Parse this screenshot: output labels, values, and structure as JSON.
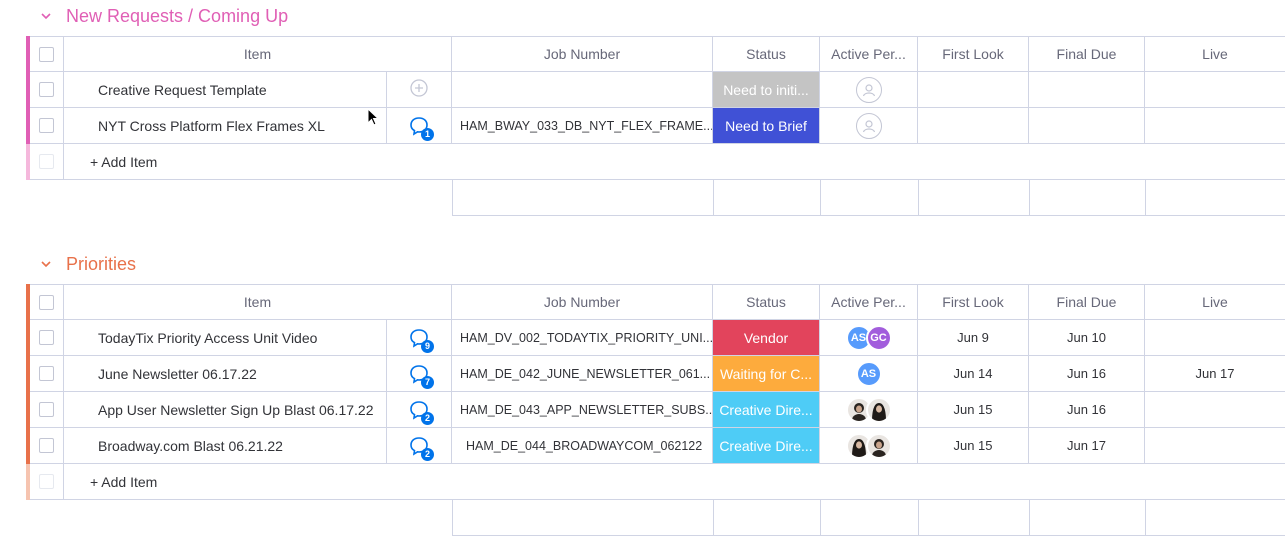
{
  "colors": {
    "group1": "#e2445c",
    "group1_title": "#e05fb5",
    "group2": "#ff642e",
    "group2_title": "#e8714a",
    "need_to_initiate": "#c4c4c4",
    "need_to_brief": "#4051d6",
    "vendor": "#e2445c",
    "waiting": "#fdab3d",
    "creative_director": "#4eccf6",
    "avatar_as": "#579bfc",
    "avatar_gc": "#a25ddc"
  },
  "headers": {
    "item": "Item",
    "job_number": "Job Number",
    "status": "Status",
    "active_person": "Active Per...",
    "first_look": "First Look",
    "final_due": "Final Due",
    "live": "Live"
  },
  "groups": [
    {
      "title": "New Requests / Coming Up",
      "add_item": "+ Add Item",
      "rows": [
        {
          "item": "Creative Request Template",
          "updates": "",
          "job_number": "",
          "status": "Need to initi...",
          "status_color": "#c4c4c4",
          "people": [],
          "first_look": "",
          "final_due": "",
          "live": ""
        },
        {
          "item": "NYT Cross Platform Flex Frames XL",
          "updates": "1",
          "job_number": "HAM_BWAY_033_DB_NYT_FLEX_FRAME...",
          "status": "Need to Brief",
          "status_color": "#4051d6",
          "people": [],
          "first_look": "",
          "final_due": "",
          "live": ""
        }
      ]
    },
    {
      "title": "Priorities",
      "add_item": "+ Add Item",
      "rows": [
        {
          "item": "TodayTix Priority Access Unit Video",
          "updates": "9",
          "job_number": "HAM_DV_002_TODAYTIX_PRIORITY_UNI...",
          "status": "Vendor",
          "status_color": "#e2445c",
          "people": [
            "AS",
            "GC"
          ],
          "first_look": "Jun 9",
          "final_due": "Jun 10",
          "live": ""
        },
        {
          "item": "June Newsletter 06.17.22",
          "updates": "7",
          "job_number": "HAM_DE_042_JUNE_NEWSLETTER_061...",
          "status": "Waiting for C...",
          "status_color": "#fdab3d",
          "people": [
            "AS"
          ],
          "first_look": "Jun 14",
          "final_due": "Jun 16",
          "live": "Jun 17"
        },
        {
          "item": "App User Newsletter Sign Up Blast 06.17.22",
          "updates": "2",
          "job_number": "HAM_DE_043_APP_NEWSLETTER_SUBS...",
          "status": "Creative Dire...",
          "status_color": "#4eccf6",
          "people": [
            "photo",
            "photo"
          ],
          "first_look": "Jun 15",
          "final_due": "Jun 16",
          "live": ""
        },
        {
          "item": "Broadway.com Blast 06.21.22",
          "updates": "2",
          "job_number": "HAM_DE_044_BROADWAYCOM_062122",
          "status": "Creative Dire...",
          "status_color": "#4eccf6",
          "people": [
            "photo",
            "photo"
          ],
          "first_look": "Jun 15",
          "final_due": "Jun 17",
          "live": ""
        }
      ]
    }
  ],
  "icons": {
    "collapse": "chevron-down-icon",
    "add_update": "add-update-icon",
    "updates": "conversation-icon",
    "empty_person": "person-icon",
    "cursor": "mouse-cursor-icon"
  }
}
